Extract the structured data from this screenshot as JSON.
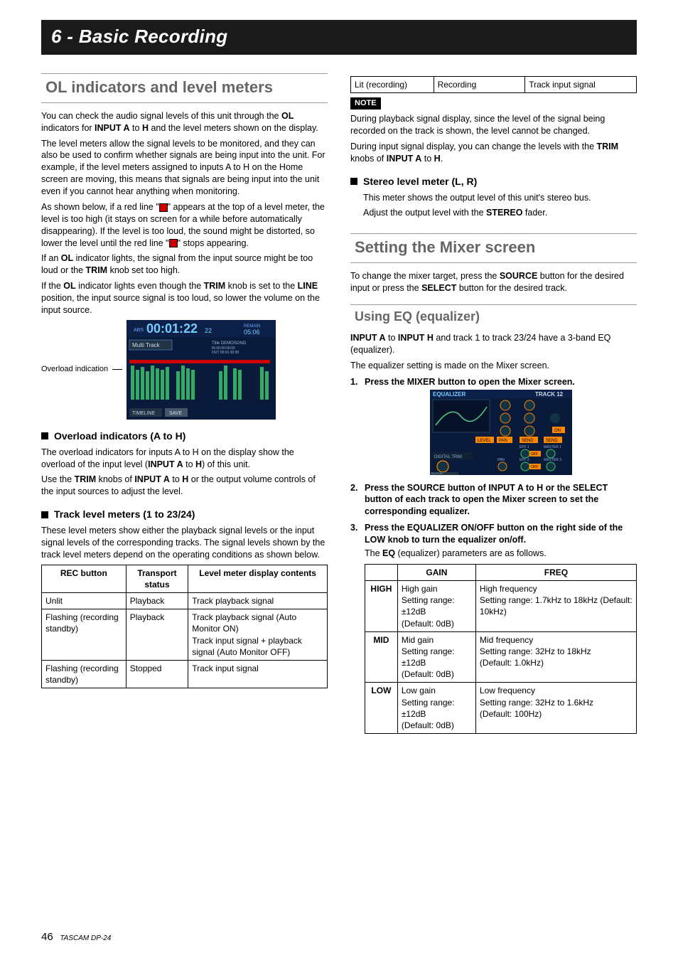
{
  "chapter": "6 - Basic Recording",
  "left": {
    "h2": "OL indicators and level meters",
    "p1a": "You can check the audio signal levels of this unit through the ",
    "p1b": "OL",
    "p1c": " indicators for ",
    "p1d": "INPUT A",
    "p1e": " to ",
    "p1f": "H",
    "p1g": " and the level meters shown on the display.",
    "p2": "The level meters allow the signal levels to be monitored, and they can also be used to confirm whether signals are being input into the unit. For example, if the level meters assigned to inputs A to H on the Home screen are moving, this means that signals are being input into the unit even if you cannot hear anything when monitoring.",
    "p3a": "As shown below, if a red line \"",
    "p3b": "\" appears at the top of a level meter, the level is too high (it stays on screen for a while before automatically disappearing). If the level is too loud, the sound might be distorted, so lower the level until the red line \"",
    "p3c": "\" stops appearing.",
    "p4a": "If an ",
    "p4b": "OL",
    "p4c": " indicator lights, the signal from the input source might be too loud or the ",
    "p4d": "TRIM",
    "p4e": " knob set too high.",
    "p5a": "If the ",
    "p5b": "OL",
    "p5c": " indicator lights even though the ",
    "p5d": "TRIM",
    "p5e": " knob is set to the ",
    "p5f": "LINE",
    "p5g": " position, the input source signal is too loud, so lower the volume on the input source.",
    "overload_label": "Overload indication",
    "fig_time": "00:01:22",
    "fig_sub": "22",
    "fig_remain_l": "REMAIN",
    "fig_remain_v": "05:06",
    "fig_mt": "Multi Track",
    "fig_title": "Title DEMOSONG",
    "fig_in": "IN   00:00:00:00",
    "fig_out": "OUT  00:01:30:00",
    "fig_timeline": "TIMELINE",
    "fig_save": "SAVE",
    "fig_abs": "ABS",
    "h_overload": "Overload indicators (A to H)",
    "ol_p1a": "The overload indicators for inputs A to H on the display show the overload of the input level (",
    "ol_p1b": "INPUT A",
    "ol_p1c": " to ",
    "ol_p1d": "H",
    "ol_p1e": ") of this unit.",
    "ol_p2a": "Use the ",
    "ol_p2b": "TRIM",
    "ol_p2c": " knobs of ",
    "ol_p2d": "INPUT A",
    "ol_p2e": " to ",
    "ol_p2f": "H",
    "ol_p2g": " or the output volume controls of the input sources to adjust the level.",
    "h_track": "Track level meters (1 to 23/24)",
    "tr_p1": "These level meters show either the playback signal levels or the input signal levels of the corresponding tracks. The signal levels shown by the track level meters depend on the operating conditions as shown below.",
    "tbl1": {
      "h1": "REC button",
      "h2": "Transport status",
      "h3": "Level meter display contents",
      "r1c1": "Unlit",
      "r1c2": "Playback",
      "r1c3": "Track playback signal",
      "r2c1": "Flashing (recording standby)",
      "r2c2": "Playback",
      "r2c3": "Track playback signal (Auto Monitor ON)\nTrack input signal + playback signal (Auto Monitor OFF)",
      "r3c1": "Flashing (recording standby)",
      "r3c2": "Stopped",
      "r3c3": "Track input signal"
    }
  },
  "right": {
    "tbl1_cont": {
      "c1": "Lit (recording)",
      "c2": "Recording",
      "c3": "Track input signal"
    },
    "note_label": "NOTE",
    "note1": "During playback signal display, since the level of the signal being recorded on the track is shown, the level cannot be changed.",
    "note2a": "During input signal display, you can change the levels with the ",
    "note2b": "TRIM",
    "note2c": " knobs of ",
    "note2d": "INPUT A",
    "note2e": " to ",
    "note2f": "H",
    "note2g": ".",
    "h_stereo": "Stereo level meter (L, R)",
    "st_p1": "This meter shows the output level of this unit's stereo bus.",
    "st_p2a": "Adjust the output level with the ",
    "st_p2b": "STEREO",
    "st_p2c": " fader.",
    "h2_mixer": "Setting the Mixer screen",
    "mx_p1a": "To change the mixer target, press the ",
    "mx_p1b": "SOURCE",
    "mx_p1c": " button for the desired input or press the ",
    "mx_p1d": "SELECT",
    "mx_p1e": " button for the desired track.",
    "h3_eq": "Using EQ (equalizer)",
    "eq_p1a": "INPUT A",
    "eq_p1b": " to ",
    "eq_p1c": "INPUT H",
    "eq_p1d": " and track 1 to track 23/24 have a 3-band EQ (equalizer).",
    "eq_p2": "The equalizer setting is made on the Mixer screen.",
    "step1": "Press the MIXER button to open the Mixer screen.",
    "mixer_fig": {
      "title": "EQUALIZER",
      "track": "TRACK 12",
      "pan": "PAN",
      "send": "SEND",
      "level": "LEVEL",
      "dt": "DIGITAL TRIM",
      "eqflat": "EQ FLAT",
      "off": "OFF",
      "on": "ON",
      "eff1": "EFF 1",
      "eff2": "EFF 2",
      "m1": "MASTER 1",
      "m2": "MASTER 2"
    },
    "step2": "Press the SOURCE button of INPUT A to H or the SELECT button of each track to open the Mixer screen to set the corresponding equalizer.",
    "step3": "Press the EQUALIZER ON/OFF button on the right side of the LOW knob to turn the equalizer on/off.",
    "step3_body_a": "The ",
    "step3_body_b": "EQ",
    "step3_body_c": " (equalizer) parameters are as follows.",
    "tbl2": {
      "h1": "GAIN",
      "h2": "FREQ",
      "rh1": "HIGH",
      "rh2": "MID",
      "rh3": "LOW",
      "r1c1": "High gain\nSetting range: ±12dB\n(Default: 0dB)",
      "r1c2": "High frequency\nSetting range: 1.7kHz to 18kHz (Default: 10kHz)",
      "r2c1": "Mid gain\nSetting range: ±12dB\n(Default: 0dB)",
      "r2c2": "Mid frequency\nSetting range: 32Hz to 18kHz\n(Default: 1.0kHz)",
      "r3c1": "Low gain\nSetting range: ±12dB\n(Default: 0dB)",
      "r3c2": "Low frequency\nSetting range: 32Hz to 1.6kHz\n(Default: 100Hz)"
    }
  },
  "footer_page": "46",
  "footer_model": "TASCAM DP-24"
}
